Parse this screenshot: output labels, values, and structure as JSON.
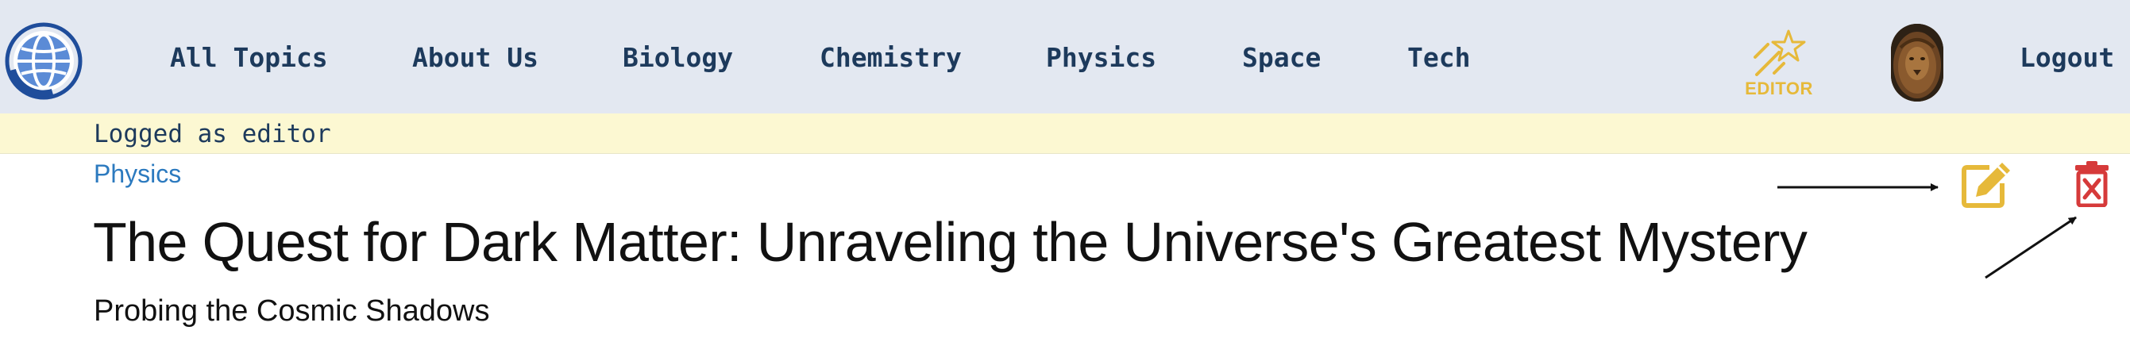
{
  "header": {
    "logo_icon": "globe-icon",
    "nav": [
      {
        "label": "All Topics"
      },
      {
        "label": "About Us"
      },
      {
        "label": "Biology"
      },
      {
        "label": "Chemistry"
      },
      {
        "label": "Physics"
      },
      {
        "label": "Space"
      },
      {
        "label": "Tech"
      }
    ],
    "editor_badge": {
      "icon": "magic-wand-icon",
      "label": "EDITOR"
    },
    "avatar_icon": "lion-avatar",
    "logout_label": "Logout"
  },
  "notice": {
    "text": "Logged as editor"
  },
  "article": {
    "breadcrumb": "Physics",
    "title": "The Quest for Dark Matter: Unraveling the Universe's Greatest Mystery",
    "subtitle": "Probing the Cosmic Shadows",
    "actions": [
      {
        "name": "edit",
        "icon": "edit-icon",
        "color": "#e6b93a"
      },
      {
        "name": "delete",
        "icon": "trash-icon",
        "color": "#d63a3a"
      }
    ]
  },
  "colors": {
    "topbar_bg": "#e3e8f1",
    "nav_text": "#1d3a5c",
    "notice_bg": "#fcf8d2",
    "link": "#2c7abf",
    "accent_gold": "#e6b93a",
    "danger": "#d63a3a"
  }
}
